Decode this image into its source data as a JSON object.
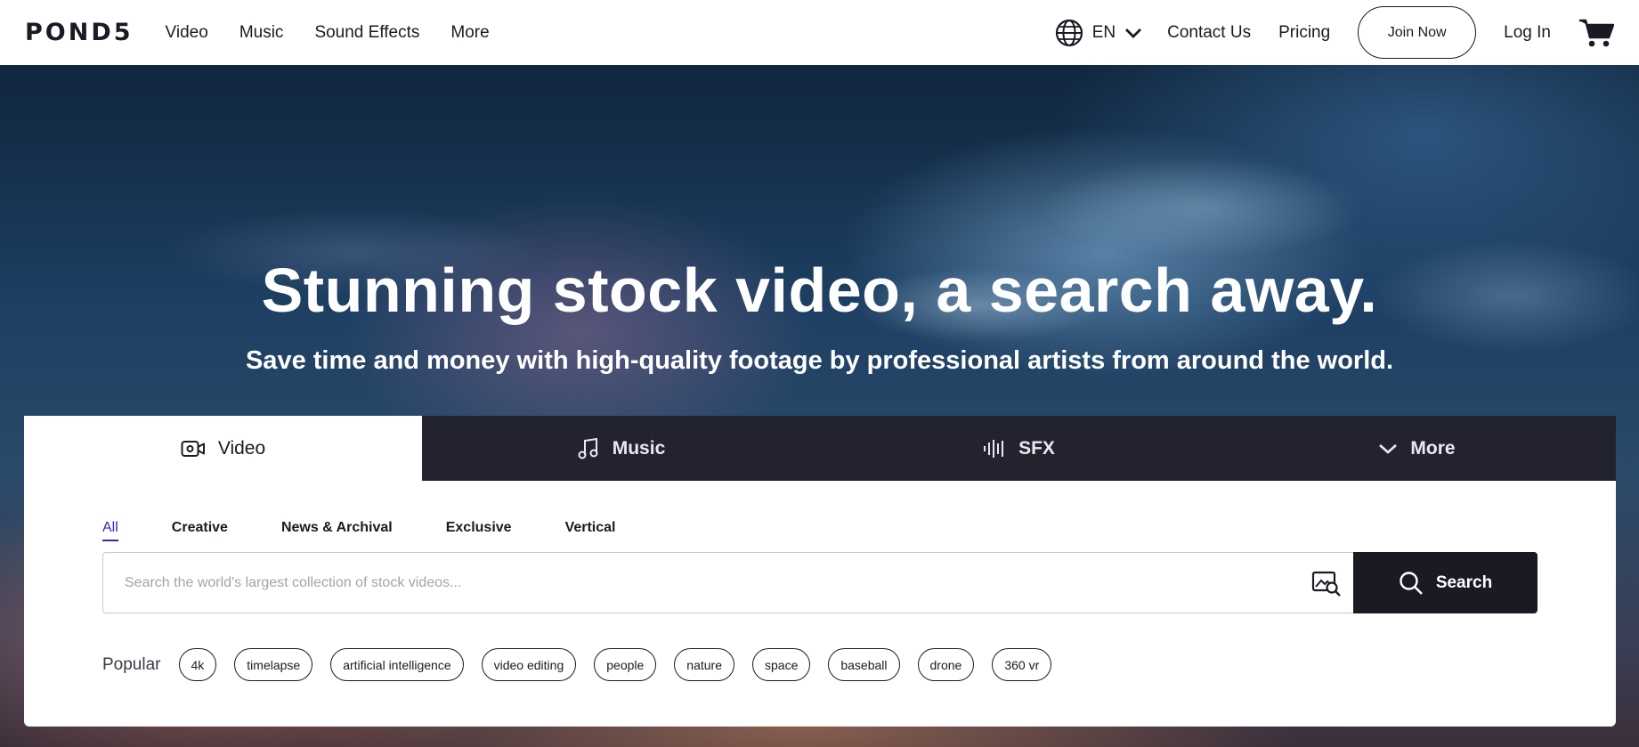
{
  "header": {
    "logo": "POND5",
    "nav": [
      "Video",
      "Music",
      "Sound Effects",
      "More"
    ],
    "language": "EN",
    "contact": "Contact Us",
    "pricing": "Pricing",
    "join": "Join Now",
    "login": "Log In"
  },
  "hero": {
    "headline": "Stunning stock video, a search away.",
    "subline": "Save time and money with high-quality footage by professional artists from around the world."
  },
  "tabs": [
    {
      "label": "Video",
      "icon": "video-camera-icon",
      "active": true
    },
    {
      "label": "Music",
      "icon": "music-note-icon"
    },
    {
      "label": "SFX",
      "icon": "waveform-icon"
    },
    {
      "label": "More",
      "icon": "chevron-down-icon"
    }
  ],
  "filters": [
    "All",
    "Creative",
    "News & Archival",
    "Exclusive",
    "Vertical"
  ],
  "search": {
    "placeholder": "Search the world's largest collection of stock videos...",
    "value": "",
    "button": "Search"
  },
  "popular": {
    "label": "Popular",
    "tags": [
      "4k",
      "timelapse",
      "artificial intelligence",
      "video editing",
      "people",
      "nature",
      "space",
      "baseball",
      "drone",
      "360 vr"
    ]
  },
  "colors": {
    "dark": "#1a1a24",
    "tabbar": "#23232f",
    "accent": "#2d2bb5"
  }
}
